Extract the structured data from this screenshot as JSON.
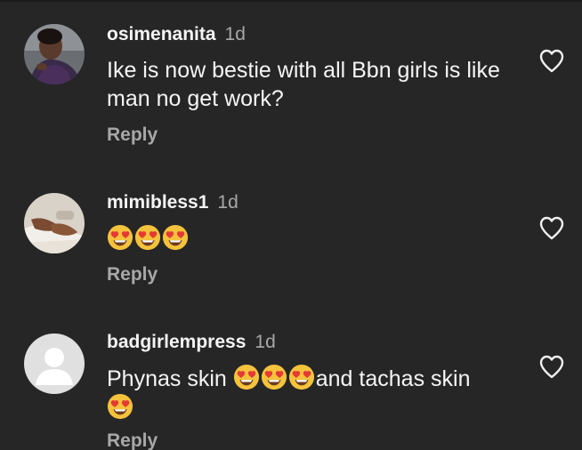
{
  "comments": [
    {
      "username": "osimenanita",
      "time": "1d",
      "text": "Ike is now bestie  with all Bbn girls  is like man no get work?",
      "reply_label": "Reply"
    },
    {
      "username": "mimibless1",
      "time": "1d",
      "text": "",
      "emoji_count": 3,
      "emoji": "heart-eyes-emoji",
      "reply_label": "Reply"
    },
    {
      "username": "badgirlempress",
      "time": "1d",
      "text_before": "Phynas skin ",
      "text_after": "and tachas skin",
      "reply_label": "Reply"
    }
  ],
  "colors": {
    "background": "#262626",
    "secondary_text": "#a8a8a8",
    "primary_text": "#f5f5f5",
    "emoji_face": "#f5c23c",
    "emoji_heart": "#e53935"
  },
  "icons": {
    "like": "heart-outline-icon",
    "avatar_default": "default-user-avatar"
  }
}
